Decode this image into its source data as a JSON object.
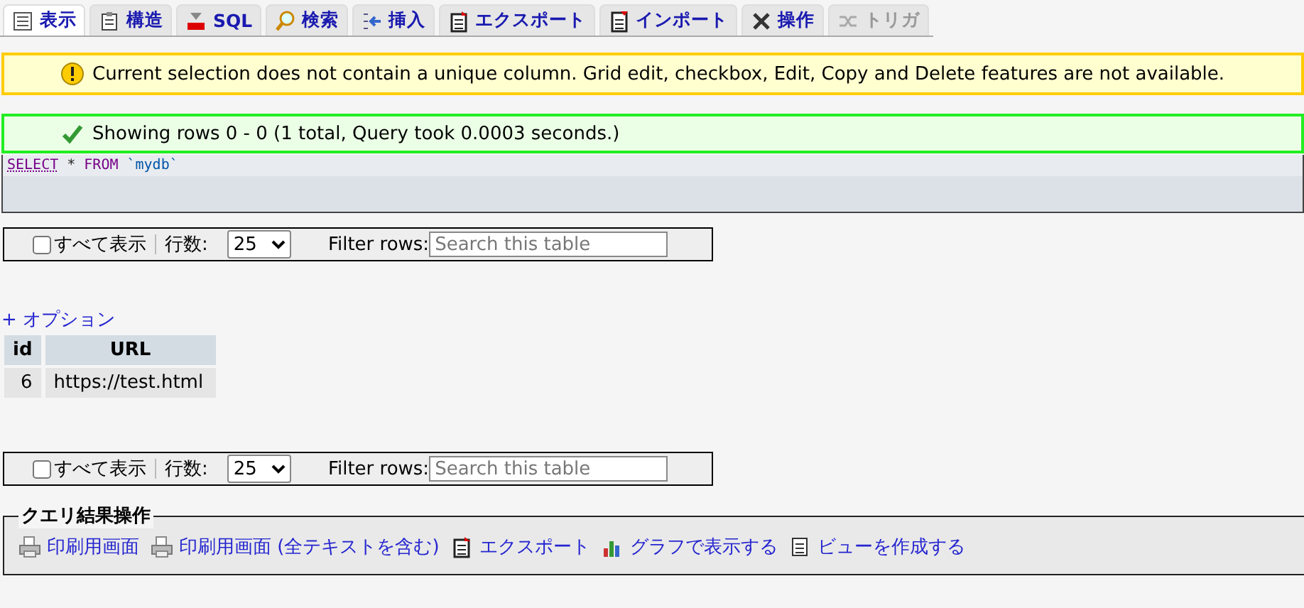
{
  "tabs": [
    {
      "label": "表示",
      "selected": true,
      "disabled": false
    },
    {
      "label": "構造",
      "selected": false,
      "disabled": false
    },
    {
      "label": "SQL",
      "selected": false,
      "disabled": false
    },
    {
      "label": "検索",
      "selected": false,
      "disabled": false
    },
    {
      "label": "挿入",
      "selected": false,
      "disabled": false
    },
    {
      "label": "エクスポート",
      "selected": false,
      "disabled": false
    },
    {
      "label": "インポート",
      "selected": false,
      "disabled": false
    },
    {
      "label": "操作",
      "selected": false,
      "disabled": false
    },
    {
      "label": "トリガ",
      "selected": false,
      "disabled": true
    }
  ],
  "notice": {
    "kind": "warning",
    "text": "Current selection does not contain a unique column. Grid edit, checkbox, Edit, Copy and Delete features are not available."
  },
  "success": {
    "kind": "success",
    "text": "Showing rows 0 - 0 (1 total, Query took 0.0003 seconds.)"
  },
  "sql_query": [
    {
      "text": "SELECT",
      "kind": "keyword"
    },
    {
      "text": "*",
      "kind": "operator"
    },
    {
      "text": "FROM",
      "kind": "keyword"
    },
    {
      "text": "`mydb`",
      "kind": "identifier"
    }
  ],
  "navigations": [
    {
      "show_all": {
        "label": "すべて表示",
        "checked": false
      },
      "rows_label": "行数:",
      "rows_value": "25",
      "filter_label": "Filter rows:",
      "filter_placeholder": "Search this table"
    },
    {
      "show_all": {
        "label": "すべて表示",
        "checked": false
      },
      "rows_label": "行数:",
      "rows_value": "25",
      "filter_label": "Filter rows:",
      "filter_placeholder": "Search this table"
    }
  ],
  "options_link": "+ オプション",
  "table": {
    "columns": [
      "id",
      "URL"
    ],
    "rows": [
      [
        "6",
        "https://test.html"
      ]
    ]
  },
  "query_results": {
    "legend": "クエリ結果操作",
    "actions": [
      {
        "label": "印刷用画面",
        "kind": "print"
      },
      {
        "label": "印刷用画面 (全テキストを含む)",
        "kind": "print"
      },
      {
        "label": "エクスポート",
        "kind": "export"
      },
      {
        "label": "グラフで表示する",
        "kind": "chart"
      },
      {
        "label": "ビューを作成する",
        "kind": "view"
      }
    ]
  }
}
